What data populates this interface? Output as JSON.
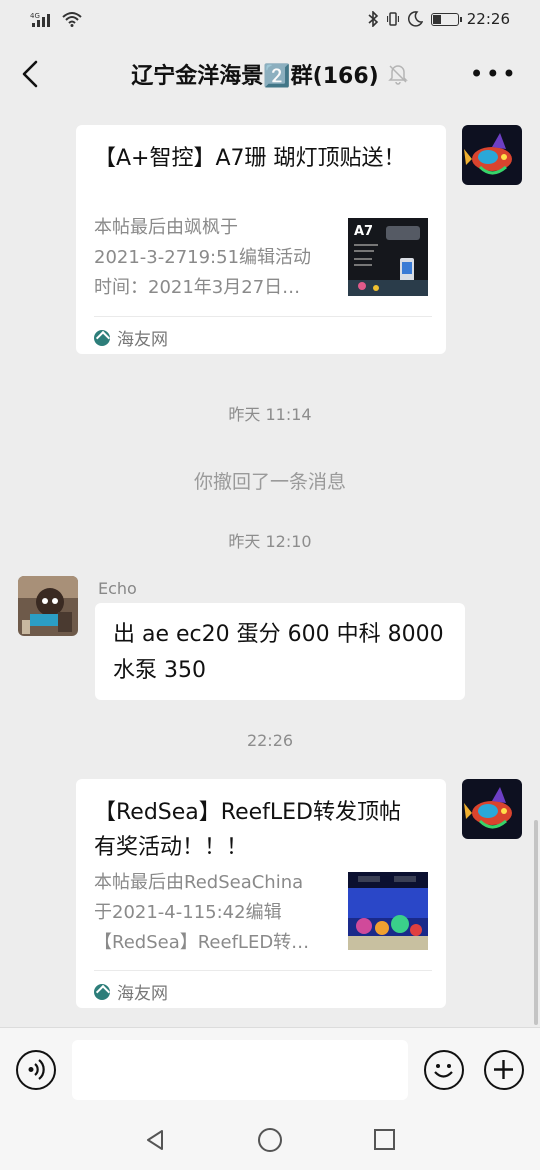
{
  "status_bar": {
    "network_label": "4G",
    "time": "22:26",
    "battery_level": 0.3
  },
  "header": {
    "title": "辽宁金洋海景2️⃣群(166)",
    "more_label": "•••"
  },
  "messages": {
    "card1": {
      "title": "【A+智控】A7珊 瑚灯顶贴送！",
      "desc_lines": [
        "本帖最后由飒枫于",
        "2021-3-2719:51编辑活动",
        "时间：2021年3月27日…"
      ],
      "thumb_label": "A7",
      "source": "海友网"
    },
    "time1": "昨天 11:14",
    "recalled": "你撤回了一条消息",
    "time2": "昨天 12:10",
    "echo": {
      "sender": "Echo",
      "text_lines": [
        "出 ae ec20 蛋分 600 中科 8000",
        "水泵 350"
      ]
    },
    "time3": "22:26",
    "card2": {
      "title": "【RedSea】ReefLED转发顶帖有奖活动！！！",
      "desc_lines": [
        "本帖最后由RedSeaChina",
        "于2021-4-115:42编辑",
        "【RedSea】ReefLED转…"
      ],
      "source": "海友网"
    }
  },
  "colors": {
    "background": "#ededed",
    "bubble": "#ffffff",
    "muted_text": "#8d8d8d",
    "source_icon": "#2d7e7a"
  }
}
